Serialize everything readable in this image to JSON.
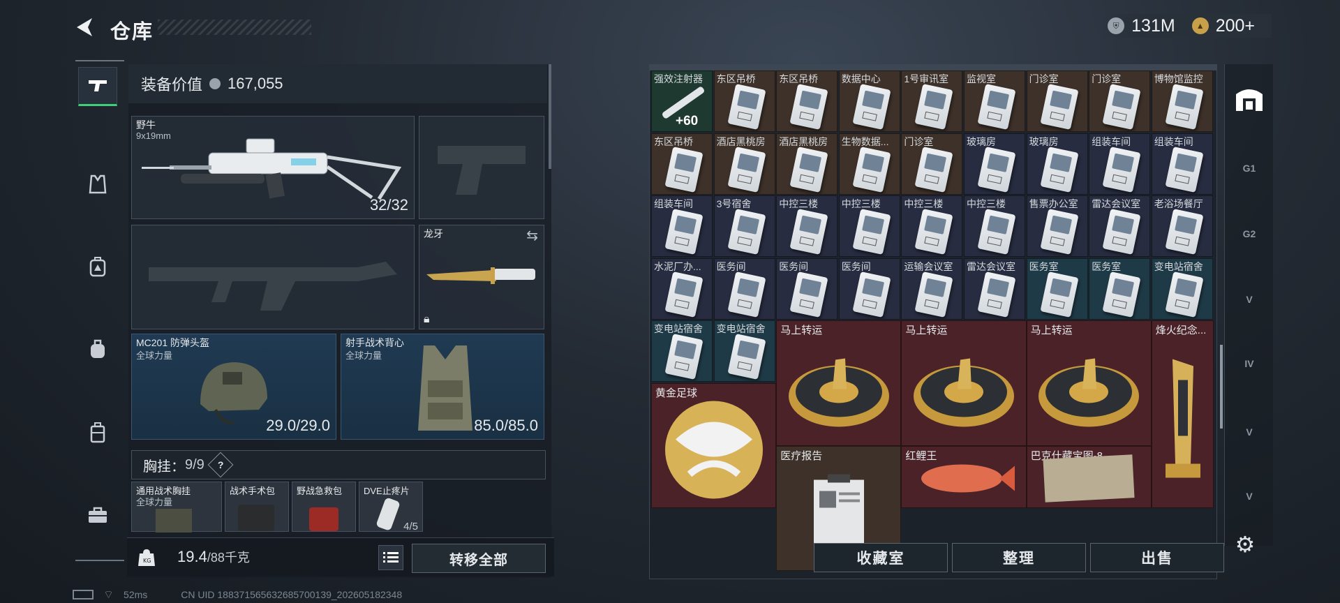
{
  "header": {
    "title": "仓库",
    "currency": [
      {
        "icon": "silver-coin-icon",
        "value": "131M"
      },
      {
        "icon": "gold-coin-icon",
        "value": "200+"
      }
    ]
  },
  "left_nav": [
    {
      "icon": "pistol-icon",
      "active": true
    },
    {
      "icon": "armor-vest-icon"
    },
    {
      "icon": "backpack-badge-icon"
    },
    {
      "icon": "backpack-icon"
    },
    {
      "icon": "luggage-icon"
    },
    {
      "icon": "toolbox-icon"
    }
  ],
  "equipment": {
    "value_label": "装备价值",
    "value": "167,055",
    "primary_weapon": {
      "name": "野牛",
      "caliber": "9x19mm",
      "ammo": "32/32"
    },
    "melee": {
      "name": "龙牙"
    },
    "helmet": {
      "name": "MC201 防弹头盔",
      "tag": "全球力量",
      "durability": "29.0/29.0"
    },
    "vest": {
      "name": "射手战术背心",
      "tag": "全球力量",
      "durability": "85.0/85.0"
    },
    "chest_rig": {
      "label": "胸挂：",
      "capacity": "9/9",
      "help": "?"
    },
    "pouches": [
      {
        "name": "通用战术胸挂",
        "tag": "全球力量"
      },
      {
        "name": "战术手术包"
      },
      {
        "name": "野战急救包"
      },
      {
        "name": "DVE止疼片",
        "count": "4/5"
      }
    ],
    "weight": "19.4",
    "weight_max": "/88千克",
    "transfer_all": "转移全部"
  },
  "status": {
    "ping": "52ms",
    "uid": "CN UID 188371565632685700139_202605182348"
  },
  "inventory": {
    "rows": [
      [
        "强效注射器",
        "东区吊桥",
        "东区吊桥",
        "数据中心",
        "1号审讯室",
        "监视室",
        "门诊室",
        "门诊室",
        "博物馆监控"
      ],
      [
        "东区吊桥",
        "酒店黑桃房",
        "酒店黑桃房",
        "生物数据...",
        "门诊室",
        "玻璃房",
        "玻璃房",
        "组装车间",
        "组装车间"
      ],
      [
        "组装车间",
        "3号宿舍",
        "中控三楼",
        "中控三楼",
        "中控三楼",
        "中控三楼",
        "售票办公室",
        "雷达会议室",
        "老浴场餐厅"
      ],
      [
        "水泥厂办...",
        "医务间",
        "医务间",
        "医务间",
        "运输会议室",
        "雷达会议室",
        "医务室",
        "医务室",
        "变电站宿舍"
      ],
      [
        "变电站宿舍",
        "变电站宿舍"
      ]
    ],
    "stack_count": "+60",
    "large_items": [
      "马上转运",
      "马上转运",
      "马上转运",
      "烽火纪念...",
      "黄金足球",
      "医疗报告",
      "红鲤王",
      "巴克什藏宝图-8"
    ]
  },
  "buttons": {
    "collection": "收藏室",
    "sort": "整理",
    "sell": "出售"
  },
  "right_nav": [
    "warehouse-icon",
    "g1-icon",
    "g2-icon",
    "v-icon",
    "iv-icon",
    "v-icon",
    "v-icon"
  ]
}
